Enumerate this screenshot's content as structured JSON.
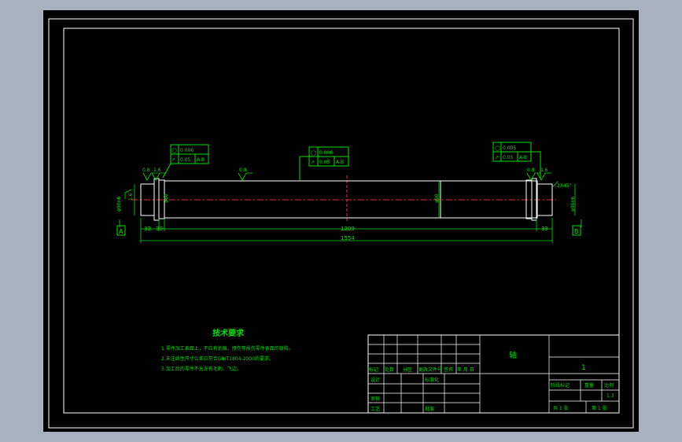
{
  "drawing": {
    "part_name": "轴",
    "datum_left": "A",
    "datum_right": "B",
    "chamfer": "2X45°",
    "dimensions": {
      "overall_length": "1554",
      "middle_length": "1209",
      "left_end": "32",
      "left_step": "30",
      "right_end": "33",
      "left_end_diameter": "φ90n6",
      "left_body_diameter": "φ80",
      "mid_diameter": "φ90",
      "right_end_diameter": "φ90n6"
    },
    "roughness": [
      "0.8",
      "1.6",
      "0.8",
      "1.6",
      "0.8",
      "1.6"
    ],
    "tolerance_left": {
      "row1_symbol": "◯",
      "row1_value": "0.006",
      "row2_symbol": "↗",
      "row2_value": "0.05",
      "row2_datum": "A-B"
    },
    "tolerance_mid": {
      "row1_symbol": "◯",
      "row1_value": "0.006",
      "row2_symbol": "↗",
      "row2_value": "0.05",
      "row2_datum": "A-B"
    },
    "tolerance_right": {
      "row1_symbol": "◯",
      "row1_value": "0.005",
      "row2_symbol": "↗",
      "row2_value": "0.05",
      "row2_datum": "A-B"
    }
  },
  "tech_requirements": {
    "title": "技术要求",
    "items": [
      "1.零件加工表面上，不应有划痕、擦伤等损伤零件表面的缺陷。",
      "2.未注线性尺寸公差应符合GB/T1804-2000的要求。",
      "3.加工后的零件不允许有毛刺、飞边。"
    ]
  },
  "title_block": {
    "part_name": "轴",
    "sheet_number": "1",
    "row_labels": [
      "标记",
      "处数",
      "分区",
      "更改文件号",
      "签名",
      "年.月.日"
    ],
    "design": "设计",
    "standardize": "标准化",
    "review": "审核",
    "process": "工艺",
    "approve": "批准",
    "stage_mark": "阶段标记",
    "weight": "重量",
    "scale_label": "比例",
    "scale": "1:3",
    "sheets_total": "共 1 张",
    "sheet_of": "第 1 张"
  }
}
